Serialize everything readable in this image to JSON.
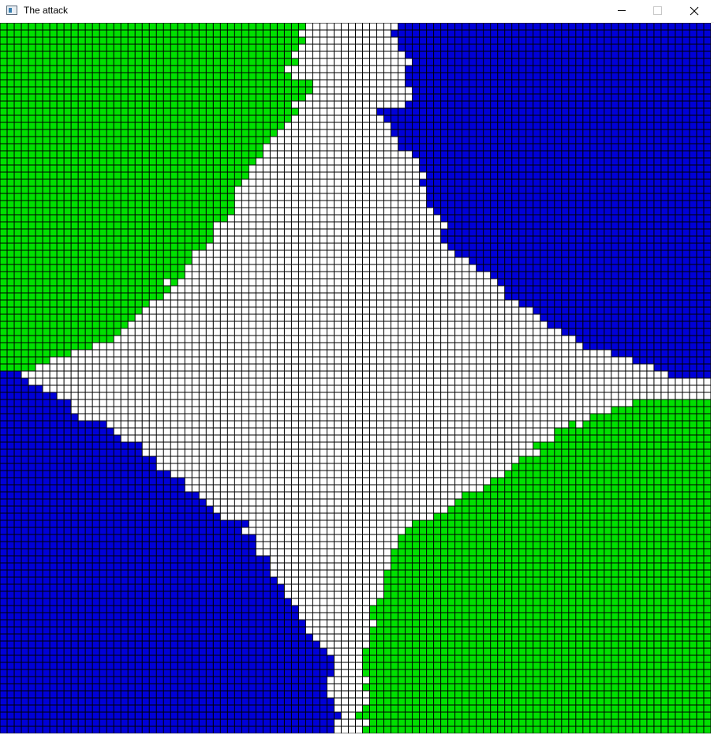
{
  "window": {
    "title": "The attack"
  },
  "board": {
    "grid_columns": 100,
    "grid_rows": 100,
    "colors": {
      "empty": "#ffffff",
      "green_team": "#00e000",
      "blue_team": "#0000d8",
      "grid_line": "#000000"
    }
  }
}
